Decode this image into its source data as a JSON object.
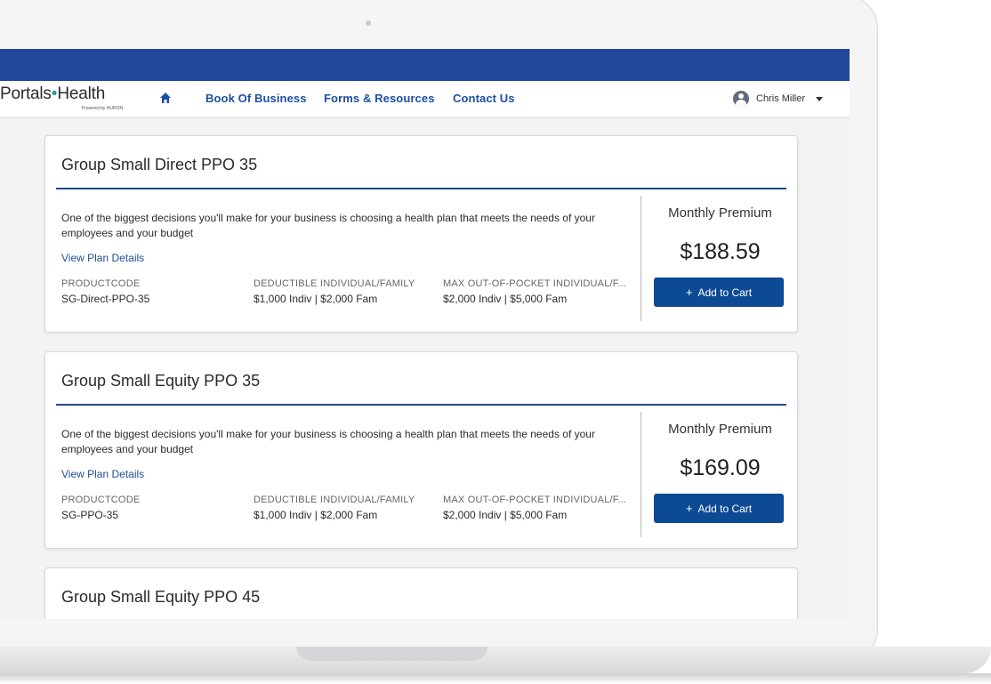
{
  "brand": {
    "name_left": "Portals",
    "name_right": "Health",
    "powered_by": "Powered by HURON"
  },
  "nav": {
    "home_icon": "home-icon",
    "links": [
      "Book Of Business",
      "Forms & Resources",
      "Contact Us"
    ],
    "user_name": "Chris Miller"
  },
  "plans": [
    {
      "title": "Group Small Direct PPO 35",
      "description": "One of the biggest decisions you'll make for your business is choosing a health plan that meets the needs of your employees and your budget",
      "link": "View Plan Details",
      "product_label": "PRODUCTCODE",
      "product_value": "SG-Direct-PPO-35",
      "deductible_label": "DEDUCTIBLE INDIVIDUAL/FAMILY",
      "deductible_value": "$1,000 Indiv | $2,000 Fam",
      "oop_label": "MAX OUT-OF-POCKET INDIVIDUAL/F...",
      "oop_value": "$2,000 Indiv | $5,000 Fam",
      "premium_label": "Monthly Premium",
      "premium_value": "$188.59",
      "cart_label": "Add to Cart"
    },
    {
      "title": "Group Small Equity PPO 35",
      "description": "One of the biggest decisions you'll make for your business is choosing a health plan that meets the needs of your employees and your budget",
      "link": "View Plan Details",
      "product_label": "PRODUCTCODE",
      "product_value": "SG-PPO-35",
      "deductible_label": "DEDUCTIBLE INDIVIDUAL/FAMILY",
      "deductible_value": "$1,000 Indiv | $2,000 Fam",
      "oop_label": "MAX OUT-OF-POCKET INDIVIDUAL/F...",
      "oop_value": "$2,000 Indiv | $5,000 Fam",
      "premium_label": "Monthly Premium",
      "premium_value": "$169.09",
      "cart_label": "Add to Cart"
    },
    {
      "title": "Group Small Equity PPO 45"
    }
  ],
  "colors": {
    "topbar": "#21489a",
    "accent": "#1e4fa1",
    "button": "#0d4a94",
    "rule": "#1d4a8b"
  }
}
